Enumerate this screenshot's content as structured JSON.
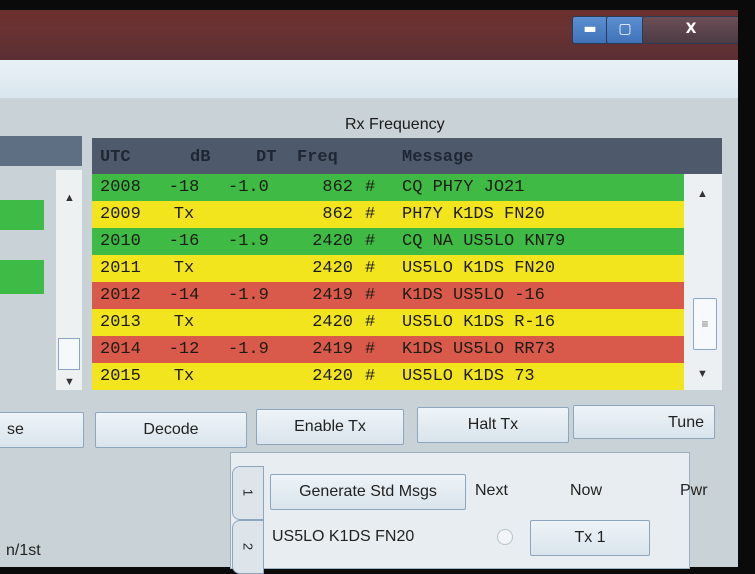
{
  "window": {
    "minimize_glyph": "▬",
    "maximize_glyph": "▢",
    "close_glyph": "X"
  },
  "rx_panel": {
    "title": "Rx Frequency",
    "columns": [
      "UTC",
      "dB",
      "DT",
      "Freq",
      "Message"
    ],
    "rows": [
      {
        "utc": "2008",
        "db": "-18",
        "dt": "-1.0",
        "freq": "862",
        "mode": "#",
        "message": "CQ PH7Y JO21",
        "color": "#3fba45"
      },
      {
        "utc": "2009",
        "db": "Tx",
        "dt": "",
        "freq": "862",
        "mode": "#",
        "message": "PH7Y K1DS FN20",
        "color": "#f2e41d"
      },
      {
        "utc": "2010",
        "db": "-16",
        "dt": "-1.9",
        "freq": "2420",
        "mode": "#",
        "message": "CQ NA US5LO KN79",
        "color": "#3fba45"
      },
      {
        "utc": "2011",
        "db": "Tx",
        "dt": "",
        "freq": "2420",
        "mode": "#",
        "message": "US5LO K1DS FN20",
        "color": "#f2e41d"
      },
      {
        "utc": "2012",
        "db": "-14",
        "dt": "-1.9",
        "freq": "2419",
        "mode": "#",
        "message": "K1DS US5LO -16",
        "color": "#d95a4a"
      },
      {
        "utc": "2013",
        "db": "Tx",
        "dt": "",
        "freq": "2420",
        "mode": "#",
        "message": "US5LO K1DS R-16",
        "color": "#f2e41d"
      },
      {
        "utc": "2014",
        "db": "-12",
        "dt": "-1.9",
        "freq": "2419",
        "mode": "#",
        "message": "K1DS US5LO RR73",
        "color": "#d95a4a"
      },
      {
        "utc": "2015",
        "db": "Tx",
        "dt": "",
        "freq": "2420",
        "mode": "#",
        "message": "US5LO K1DS 73",
        "color": "#f2e41d"
      }
    ]
  },
  "buttons": {
    "erase_partial": "se",
    "decode": "Decode",
    "enable_tx": "Enable Tx",
    "halt_tx": "Halt Tx",
    "tune": "Tune"
  },
  "tabs": {
    "tab1": "1",
    "tab2": "2",
    "generate_std_msgs": "Generate Std Msgs",
    "next_label": "Next",
    "now_label": "Now",
    "pwr_label": "Pwr",
    "tx1_message": "US5LO K1DS FN20",
    "tx1_button": "Tx 1"
  },
  "left_panel": {
    "bottom_text": "n/1st"
  }
}
